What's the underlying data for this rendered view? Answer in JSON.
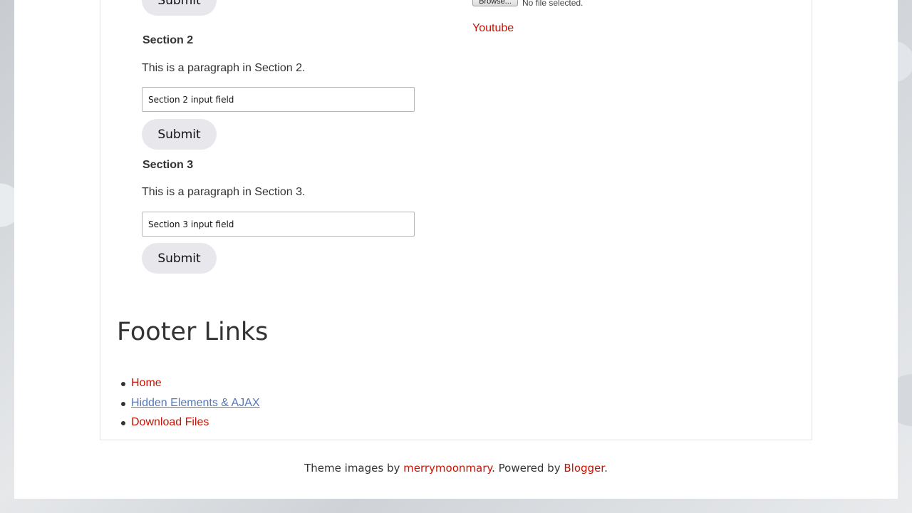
{
  "sections": [
    {
      "submit_label": "Submit"
    },
    {
      "title": "Section 2",
      "paragraph": "This is a paragraph in Section 2.",
      "input_value": "Section 2 input field",
      "submit_label": "Submit"
    },
    {
      "title": "Section 3",
      "paragraph": "This is a paragraph in Section 3.",
      "input_value": "Section 3 input field",
      "submit_label": "Submit"
    }
  ],
  "sidebar": {
    "file_input": {
      "button_label": "Browse...",
      "status": "No file selected."
    },
    "youtube_link": "Youtube"
  },
  "footer": {
    "heading": "Footer Links",
    "links": [
      "Home",
      "Hidden Elements & AJAX",
      "Download Files"
    ]
  },
  "attribution": {
    "prefix": "Theme images by ",
    "author": "merrymoonmary",
    "middle": ". Powered by ",
    "platform": "Blogger",
    "suffix": "."
  },
  "colors": {
    "link": "#cc1100",
    "visited_link": "#5577bb",
    "button_bg": "#e8e8ec"
  }
}
